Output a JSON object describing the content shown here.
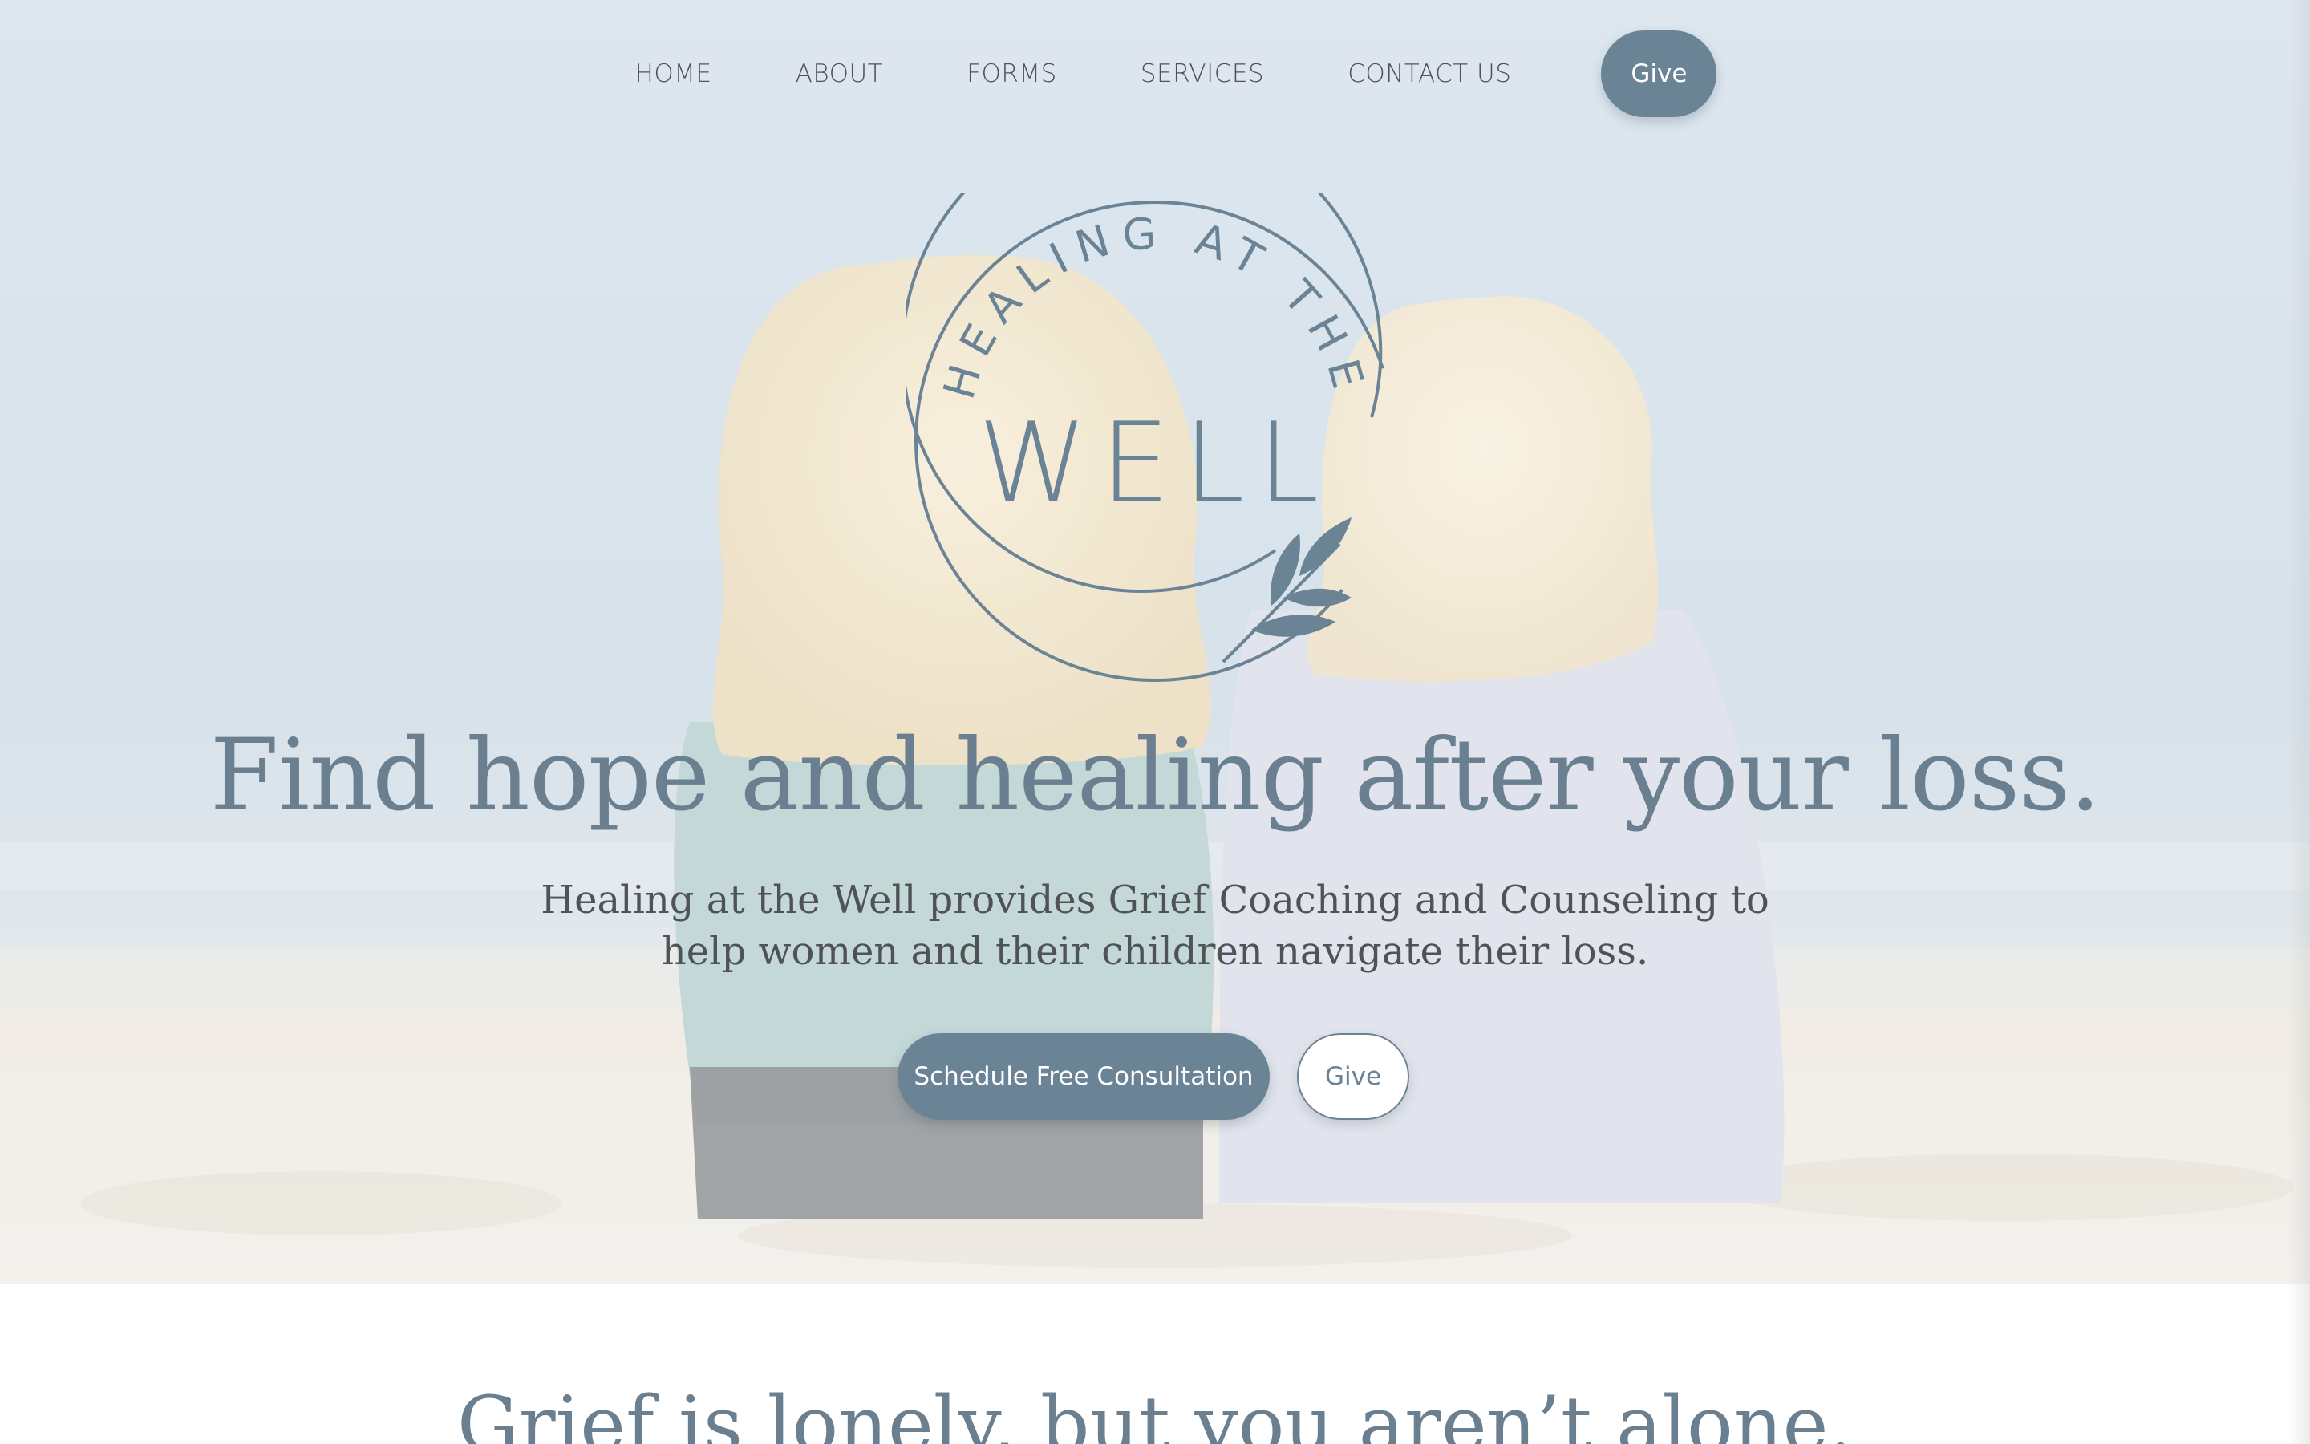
{
  "nav": {
    "items": [
      "HOME",
      "ABOUT",
      "FORMS",
      "SERVICES",
      "CONTACT US"
    ],
    "give_label": "Give"
  },
  "logo": {
    "arc_text": "HEALING AT THE",
    "main_text": "WELL",
    "icon": "leaf-branch-icon"
  },
  "hero": {
    "headline": "Find hope and healing after your loss.",
    "subhead": "Healing at the Well provides Grief Coaching and Counseling to help women and their children navigate their loss.",
    "primary_cta": "Schedule Free Consultation",
    "secondary_cta": "Give"
  },
  "section2": {
    "heading": "Grief is lonely, but you aren’t alone."
  },
  "colors": {
    "accent": "#6a8395",
    "heading": "#6a7f90",
    "body_text": "#4f5256",
    "nav_text": "#4c5257"
  }
}
